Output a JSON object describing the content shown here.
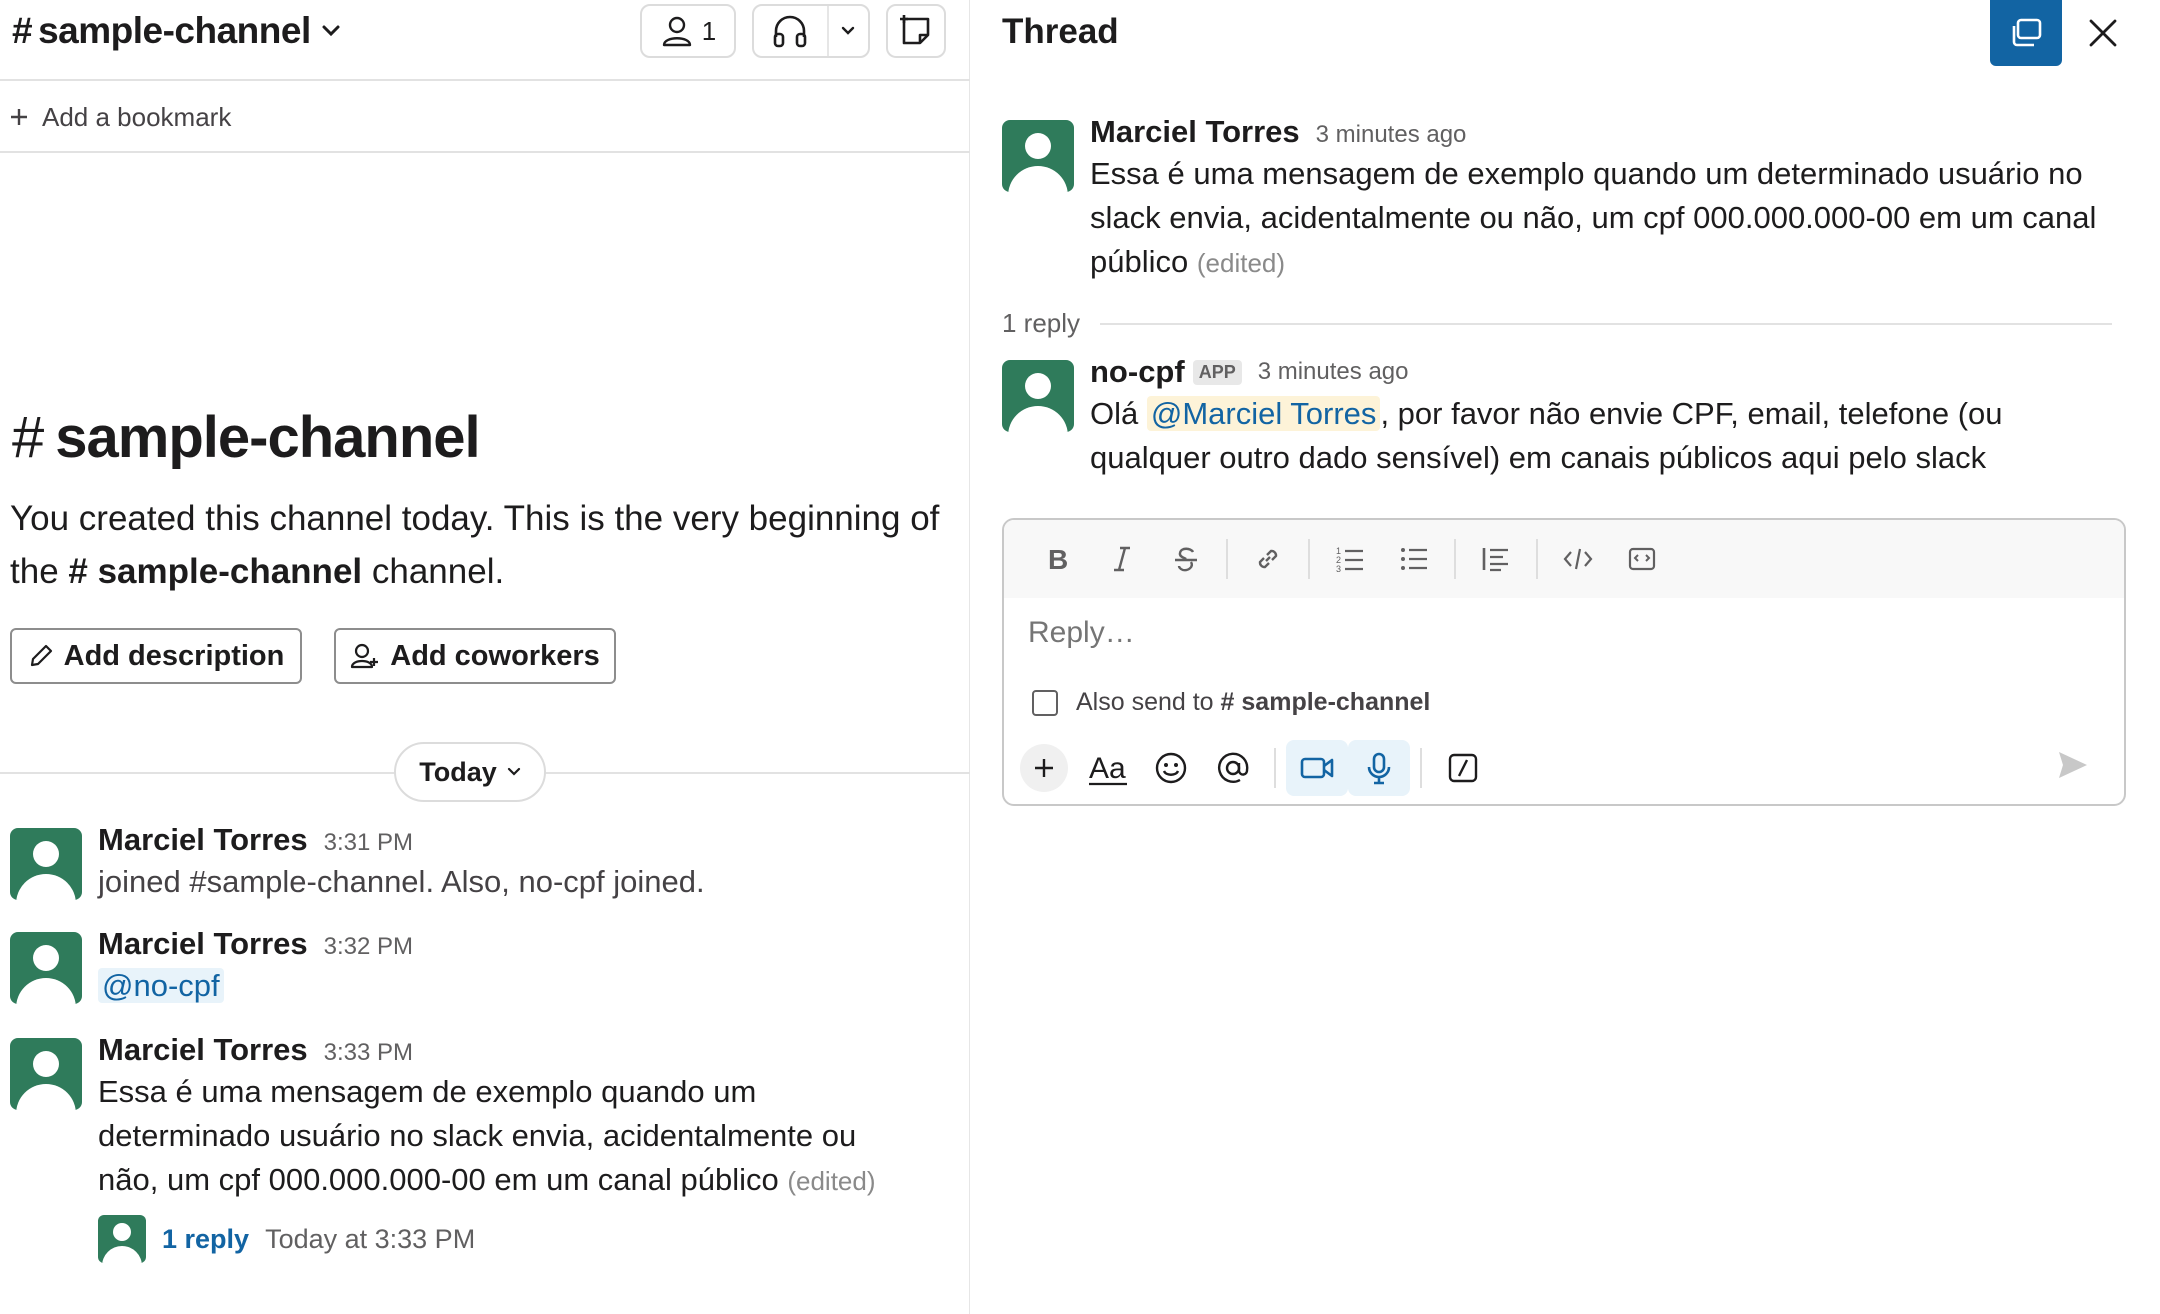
{
  "channel": {
    "name": "sample-channel",
    "member_count": "1",
    "bookmark_label": "Add a bookmark"
  },
  "intro": {
    "title": "sample-channel",
    "text_before": "You created this channel today. This is the very beginning of the",
    "channel_name": "sample-channel",
    "text_after": "channel.",
    "add_description": "Add description",
    "add_coworkers": "Add coworkers"
  },
  "day_divider": "Today",
  "messages": [
    {
      "author": "Marciel Torres",
      "time": "3:31 PM",
      "text": "joined #sample-channel. Also, no-cpf joined."
    },
    {
      "author": "Marciel Torres",
      "time": "3:32 PM",
      "mention": "@no-cpf"
    },
    {
      "author": "Marciel Torres",
      "time": "3:33 PM",
      "text": "Essa é uma mensagem de exemplo quando um determinado usuário no slack envia, acidentalmente ou não, um cpf 000.000.000-00 em um canal público",
      "edited": "(edited)",
      "reply_link": "1 reply",
      "reply_time": "Today at 3:33 PM"
    }
  ],
  "thread": {
    "title": "Thread",
    "parent": {
      "author": "Marciel Torres",
      "time": "3 minutes ago",
      "text": "Essa é uma mensagem de exemplo quando um determinado usuário no slack envia, acidentalmente ou não, um cpf 000.000.000-00 em um canal público",
      "edited": "(edited)"
    },
    "reply_count": "1 reply",
    "reply": {
      "author": "no-cpf",
      "badge": "APP",
      "time": "3 minutes ago",
      "text_before": "Olá",
      "mention": "@Marciel Torres",
      "text_after": ", por favor não envie CPF, email, telefone (ou qualquer outro dado sensível) em canais públicos aqui pelo slack"
    },
    "composer": {
      "placeholder": "Reply…",
      "also_send_label": "Also send to",
      "also_send_channel": "sample-channel"
    }
  },
  "colors": {
    "avatar": "#2f7b5b",
    "link": "#1264a3",
    "mention_bg": "#e8f3fa",
    "popout_button": "#1264a3"
  }
}
